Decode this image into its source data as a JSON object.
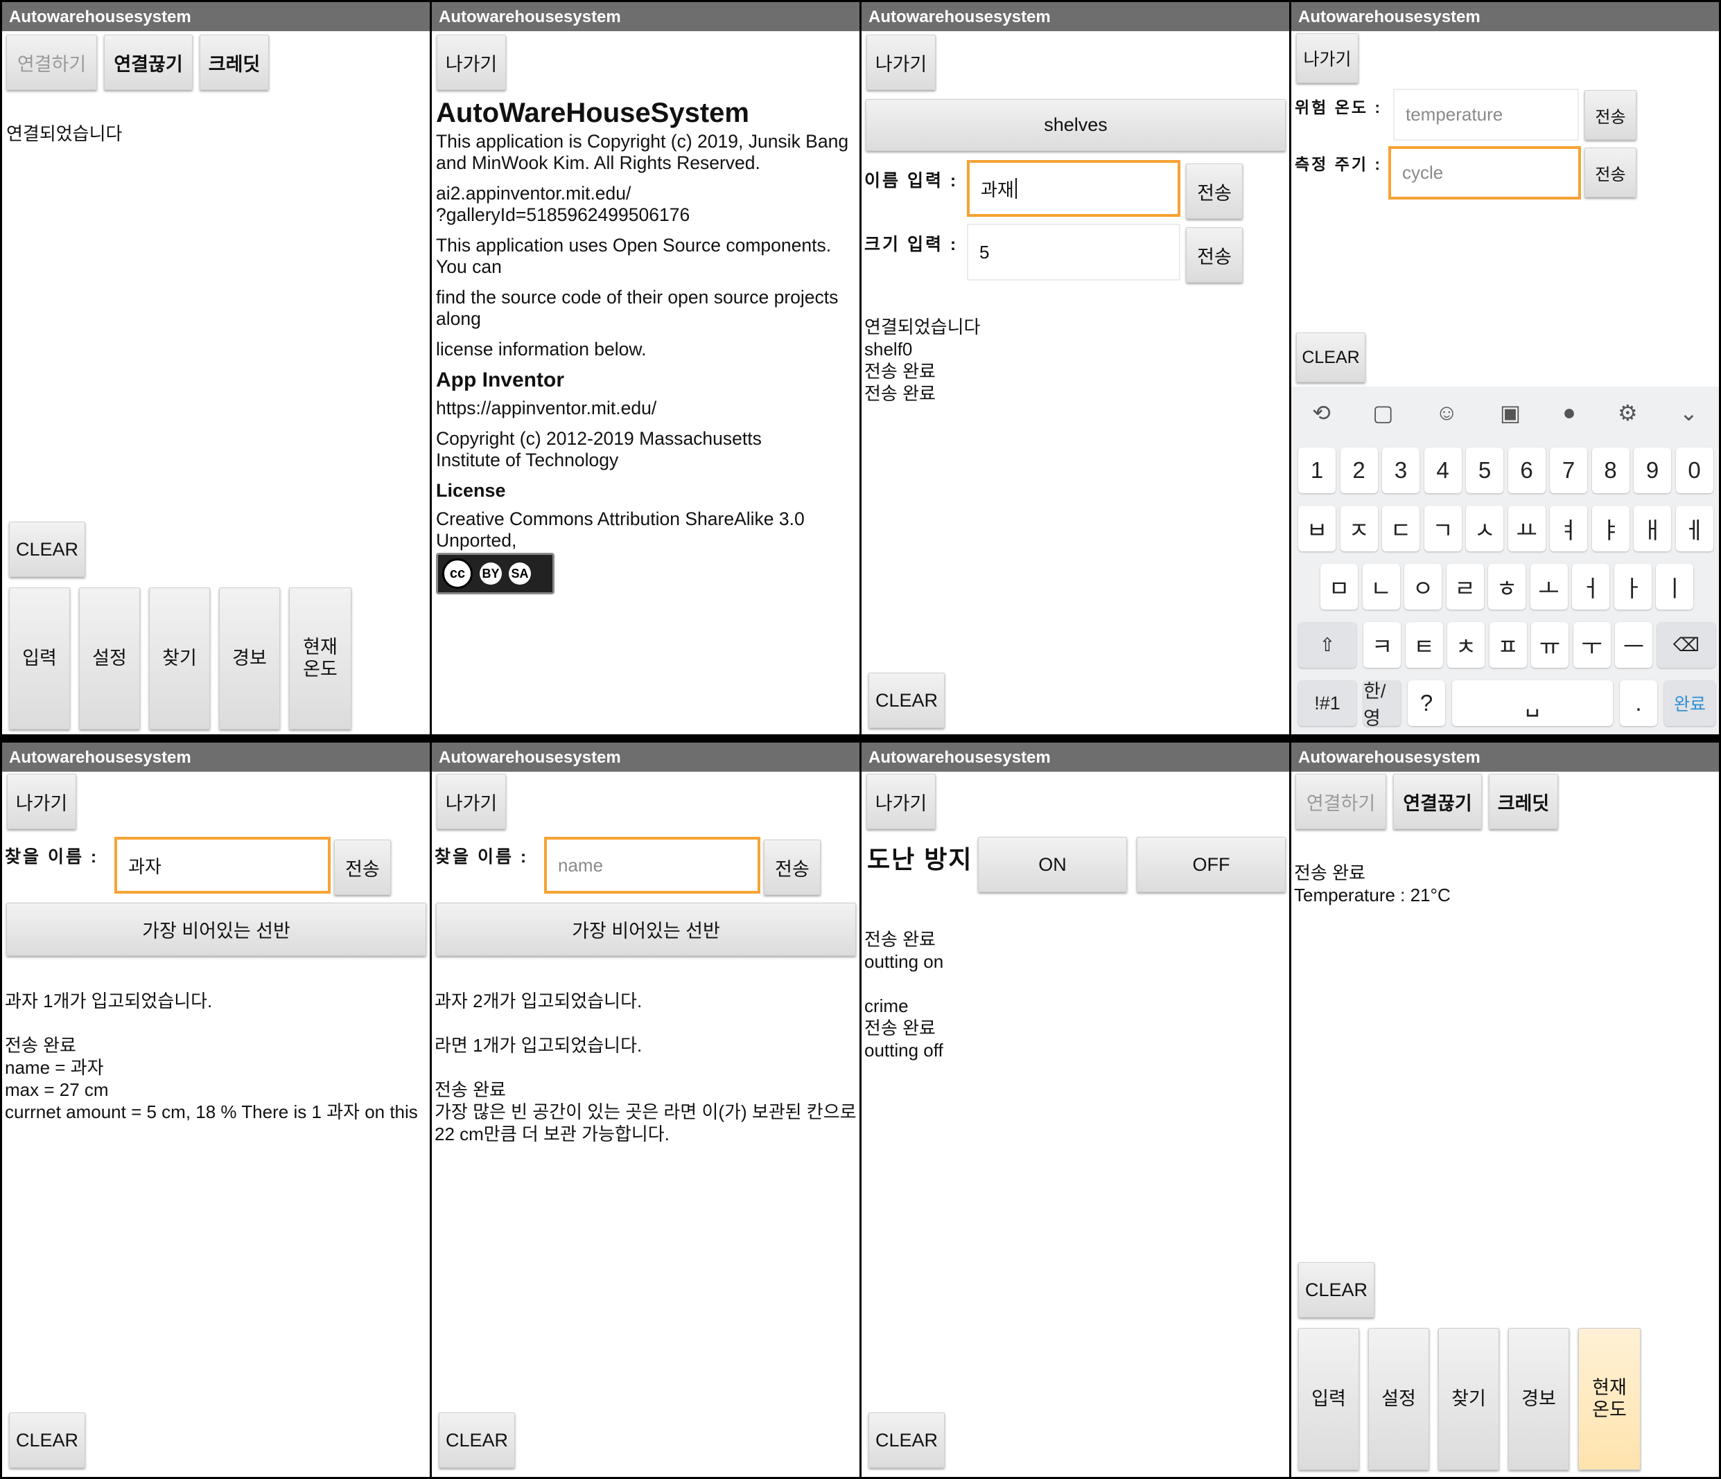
{
  "app_title": "Autowarehousesystem",
  "common": {
    "exit": "나가기",
    "send": "전송",
    "clear": "CLEAR",
    "connect": "연결하기",
    "disconnect": "연결끊기",
    "credit": "크레딧",
    "menu": {
      "input": "입력",
      "settings": "설정",
      "find": "찾기",
      "alarm": "경보",
      "current_temp": "현재\n온도"
    }
  },
  "panel1": {
    "status": "연결되었습니다"
  },
  "panel2": {
    "heading": "AutoWareHouseSystem",
    "copyright": "This application is Copyright (c) 2019, Junsik Bang\n and MinWook Kim. All Rights Reserved.",
    "gallery": "ai2.appinventor.mit.edu/\n?galleryId=5185962499506176",
    "open_source_1": "This application uses Open Source components. You can",
    "open_source_2": "find the source code of their open source projects along",
    "open_source_3": "license information below.",
    "app_inventor": "App Inventor",
    "ai_url": "https://appinventor.mit.edu/",
    "ai_copyright": "Copyright (c) 2012-2019 Massachusetts\n Institute of Technology",
    "license_title": "License",
    "license_text": "Creative Commons Attribution ShareAlike 3.0 Unported,",
    "badge_cc": "cc",
    "badge_by": "BY",
    "badge_sa": "SA"
  },
  "panel3": {
    "shelves_button": "shelves",
    "name_label": "이름 입력 :",
    "name_value": "과재",
    "size_label": "크기 입력 :",
    "size_value": "5",
    "log": "연결되었습니다\nshelf0\n전송 완료\n전송 완료"
  },
  "panel4": {
    "danger_label": "위험 온도 :",
    "danger_placeholder": "temperature",
    "cycle_label": "측정 주기 :",
    "cycle_placeholder": "cycle",
    "keyboard": {
      "numbers": [
        "1",
        "2",
        "3",
        "4",
        "5",
        "6",
        "7",
        "8",
        "9",
        "0"
      ],
      "row1": [
        "ㅂ",
        "ㅈ",
        "ㄷ",
        "ㄱ",
        "ㅅ",
        "ㅛ",
        "ㅕ",
        "ㅑ",
        "ㅐ",
        "ㅔ"
      ],
      "row2": [
        "ㅁ",
        "ㄴ",
        "ㅇ",
        "ㄹ",
        "ㅎ",
        "ㅗ",
        "ㅓ",
        "ㅏ",
        "ㅣ"
      ],
      "row3": [
        "ㅋ",
        "ㅌ",
        "ㅊ",
        "ㅍ",
        "ㅠ",
        "ㅜ",
        "ㅡ"
      ],
      "sym_key": "!#1",
      "lang_key": "한/영",
      "question_key": "?",
      "period_key": ".",
      "done_key": "완료",
      "space_key": "␣",
      "shift_key": "⇧",
      "backspace_key": "⌫"
    }
  },
  "panel5": {
    "find_label": "찾을 이름 :",
    "find_value": "과자",
    "emptiest_button": "가장 비어있는 선반",
    "log": "과자 1개가 입고되었습니다.\n\n전송 완료\nname = 과자\nmax = 27 cm\ncurrnet amount = 5 cm, 18 % There is 1 과자 on this"
  },
  "panel6": {
    "find_label": "찾을 이름 :",
    "find_placeholder": "name",
    "emptiest_button": "가장 비어있는 선반",
    "log": "과자 2개가 입고되었습니다.\n\n라면 1개가 입고되었습니다.\n\n전송 완료\n가장 많은 빈 공간이 있는 곳은 라면 이(가) 보관된 칸으로\n22 cm만큼 더 보관 가능합니다."
  },
  "panel7": {
    "theft_label": "도난 방지",
    "on": "ON",
    "off": "OFF",
    "log": "전송 완료\noutting on\n\ncrime\n전송 완료\noutting off"
  },
  "panel8": {
    "log": "전송 완료\nTemperature : 21°C"
  }
}
